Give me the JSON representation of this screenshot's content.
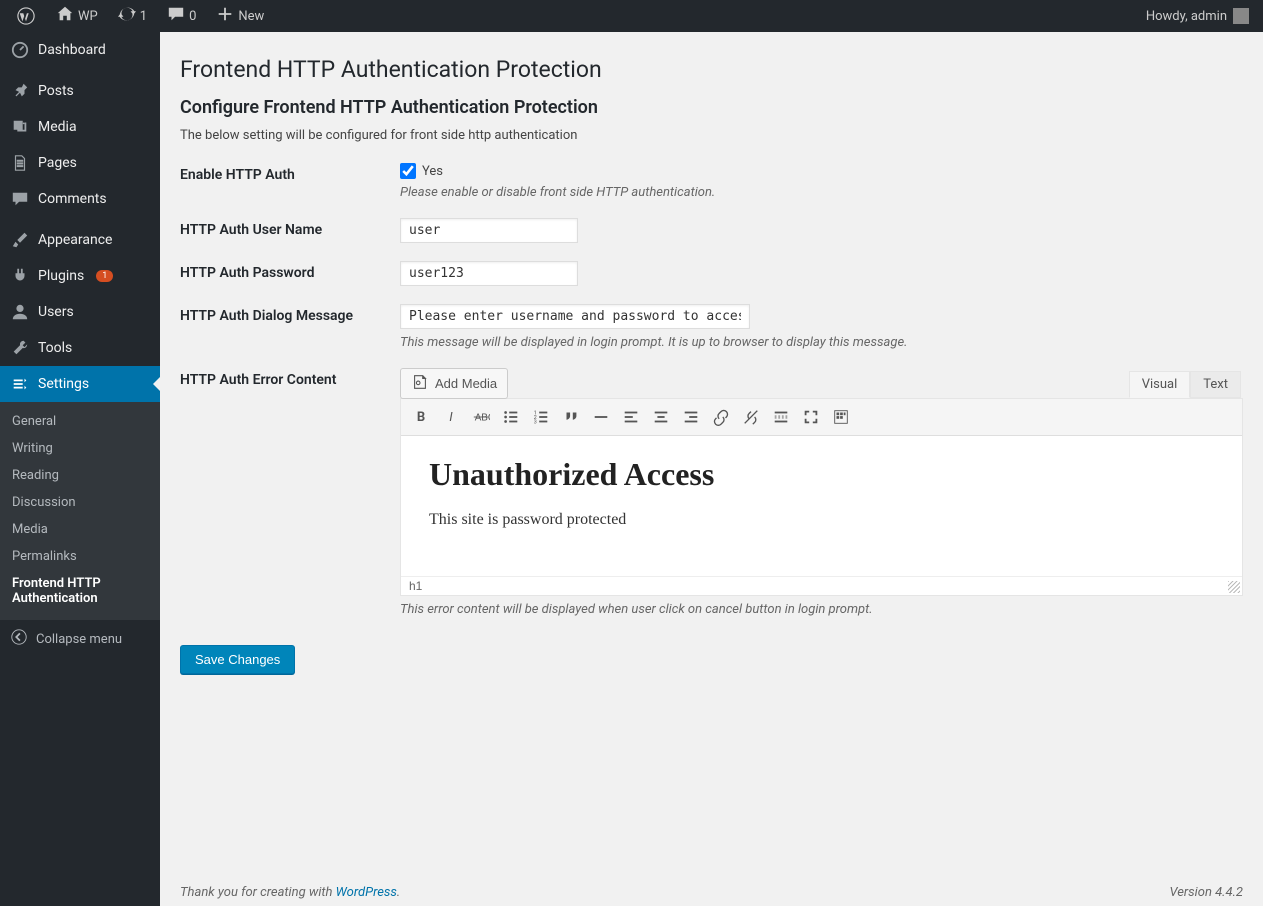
{
  "topbar": {
    "site_name": "WP",
    "updates_count": "1",
    "comments_count": "0",
    "new_label": "New",
    "howdy": "Howdy, admin"
  },
  "sidebar": {
    "items": [
      {
        "label": "Dashboard",
        "icon": "dashboard"
      },
      {
        "label": "Posts",
        "icon": "pin"
      },
      {
        "label": "Media",
        "icon": "media"
      },
      {
        "label": "Pages",
        "icon": "pages"
      },
      {
        "label": "Comments",
        "icon": "comment"
      },
      {
        "label": "Appearance",
        "icon": "brush"
      },
      {
        "label": "Plugins",
        "icon": "plug",
        "badge": "1"
      },
      {
        "label": "Users",
        "icon": "user"
      },
      {
        "label": "Tools",
        "icon": "wrench"
      },
      {
        "label": "Settings",
        "icon": "settings",
        "active": true
      }
    ],
    "submenu": [
      "General",
      "Writing",
      "Reading",
      "Discussion",
      "Media",
      "Permalinks",
      "Frontend HTTP Authentication"
    ],
    "collapse_label": "Collapse menu"
  },
  "page": {
    "title": "Frontend HTTP Authentication Protection",
    "section_title": "Configure Frontend HTTP Authentication Protection",
    "section_desc": "The below setting will be configured for front side http authentication",
    "fields": {
      "enable_label": "Enable HTTP Auth",
      "enable_yes": "Yes",
      "enable_help": "Please enable or disable front side HTTP authentication.",
      "user_label": "HTTP Auth User Name",
      "user_value": "user",
      "pass_label": "HTTP Auth Password",
      "pass_value": "user123",
      "msg_label": "HTTP Auth Dialog Message",
      "msg_value": "Please enter username and password to access",
      "msg_help": "This message will be displayed in login prompt. It is up to browser to display this message.",
      "error_label": "HTTP Auth Error Content",
      "add_media": "Add Media",
      "tab_visual": "Visual",
      "tab_text": "Text",
      "error_heading": "Unauthorized Access",
      "error_body": "This site is password protected",
      "error_status": "h1",
      "error_help": "This error content will be displayed when user click on cancel button in login prompt.",
      "save_label": "Save Changes"
    }
  },
  "footer": {
    "thanks_pre": "Thank you for creating with ",
    "thanks_link": "WordPress",
    "version": "Version 4.4.2"
  }
}
